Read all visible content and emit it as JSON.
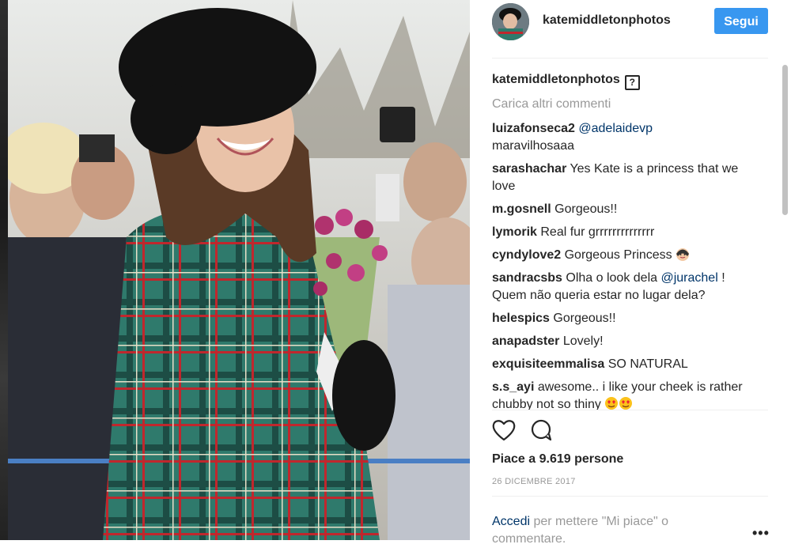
{
  "post": {
    "username": "katemiddletonphotos",
    "follow_label": "Segui"
  },
  "caption": {
    "username": "katemiddletonphotos",
    "verify_glyph": "?"
  },
  "load_more_label": "Carica altri commenti",
  "comments": [
    {
      "user": "luizafonseca2",
      "mention": "@adelaidevp",
      "text": " maravilhosaaa"
    },
    {
      "user": "sarashachar",
      "text": "Yes Kate is a princess that we love"
    },
    {
      "user": "m.gosnell",
      "text": "Gorgeous!!"
    },
    {
      "user": "lymorik",
      "text": "Real fur grrrrrrrrrrrrrr"
    },
    {
      "user": "cyndylove2",
      "text": "Gorgeous Princess"
    },
    {
      "user": "sandracsbs",
      "text_before": "Olha o look dela ",
      "mention": "@jurachel",
      "text": " ! Quem não queria estar no lugar dela?"
    },
    {
      "user": "helespics",
      "text": "Gorgeous!!"
    },
    {
      "user": "anapadster",
      "text": "Lovely!"
    },
    {
      "user": "exquisiteemmalisa",
      "text": "SO NATURAL"
    },
    {
      "user": "s.s_ayi",
      "text": "awesome.. i like your cheek is rather chubby not so thiny"
    }
  ],
  "icons": {
    "like": "heart-icon",
    "comment": "comment-icon",
    "more": "more-options-icon"
  },
  "likes_text": "Piace a 9.619 persone",
  "date_text": "26 DICEMBRE 2017",
  "login": {
    "link": "Accedi",
    "text": " per mettere \"Mi piace\" o commentare."
  },
  "more_glyph": "•••",
  "colors": {
    "accent": "#3897f0",
    "link": "#003569",
    "muted": "#999999"
  }
}
